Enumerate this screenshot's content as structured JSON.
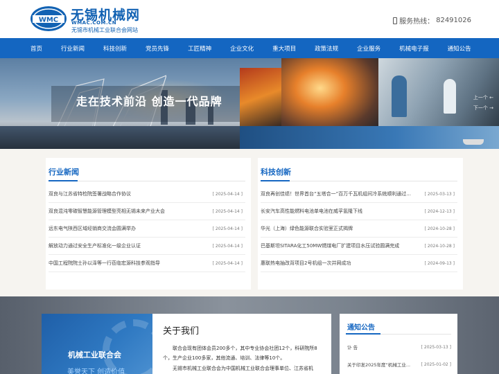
{
  "header": {
    "logo_title": "无锡机械网",
    "logo_domain": "WMAC.COM.CN",
    "logo_subtitle": "无锡市机械工业联合会网站",
    "logo_mark_text": "WMC",
    "hotline_label": "服务热线：",
    "hotline_number": "82491026"
  },
  "nav": {
    "items": [
      "首页",
      "行业新闻",
      "科技创新",
      "党员先锋",
      "工匠精神",
      "企业文化",
      "重大项目",
      "政策法规",
      "企业服务",
      "机械电子报",
      "通知公告"
    ]
  },
  "banner": {
    "slogan": "走在技术前沿 创造一代品牌",
    "prev_label": "上一个",
    "next_label": "下一个",
    "prev_arrow": "←",
    "next_arrow": "→"
  },
  "industry_news": {
    "title": "行业新闻",
    "items": [
      {
        "text": "双良与江苏省特检院签署战略合作协议",
        "date": "[ 2025-04-14 ]"
      },
      {
        "text": "双良混沌零碳智慧能源管理模型亮相无锡未来产业大会",
        "date": "[ 2025-04-14 ]"
      },
      {
        "text": "远东电气陕西区域经销商交流会圆满举办",
        "date": "[ 2025-04-14 ]"
      },
      {
        "text": "解放动力通过安全生产标准化一级企业认证",
        "date": "[ 2025-04-14 ]"
      },
      {
        "text": "中国工程院院士孙以泽等一行莅临宏源科技参观指导",
        "date": "[ 2025-04-14 ]"
      }
    ]
  },
  "tech_innovation": {
    "title": "科技创新",
    "items": [
      {
        "text": "双良再创佳绩！世界首台“五塔合一”百万千瓦机组间冷系统顺利通过...",
        "date": "[ 2025-03-13 ]"
      },
      {
        "text": "长安汽车高性能燃料电池单电池在威孚氢隆下线",
        "date": "[ 2024-12-13 ]"
      },
      {
        "text": "华光（上海）绿色能源联合实验室正式揭牌",
        "date": "[ 2024-10-28 ]"
      },
      {
        "text": "巴基斯坦SITARA化工50MW燃煤电厂扩建项目水压试验圆满完成",
        "date": "[ 2024-10-28 ]"
      },
      {
        "text": "惠联热电抽改背项目2号机组一次并网成功",
        "date": "[ 2024-09-13 ]"
      }
    ]
  },
  "promo": {
    "title": "机械工业联合会",
    "subtitle": "美誉天下 创造价值"
  },
  "about": {
    "title": "关于我们",
    "paragraph1": "联合会现有团体会员200多个，其中专业协会社团12个，科研院所8个，生产企业100多家，其他流通、培训、法律等10个。",
    "paragraph2": "无锡市机械工业联合会为中国机械工业联合会理事单位、江苏省机"
  },
  "notice": {
    "title": "通知公告",
    "items": [
      {
        "text": "讣 告",
        "date": "[ 2025-03-13 ]"
      },
      {
        "text": "关于印发2025年度“机械工业...",
        "date": "[ 2025-01-02 ]"
      }
    ]
  },
  "colors": {
    "brand_blue": "#1466c1",
    "logo_blue": "#1262b3"
  }
}
